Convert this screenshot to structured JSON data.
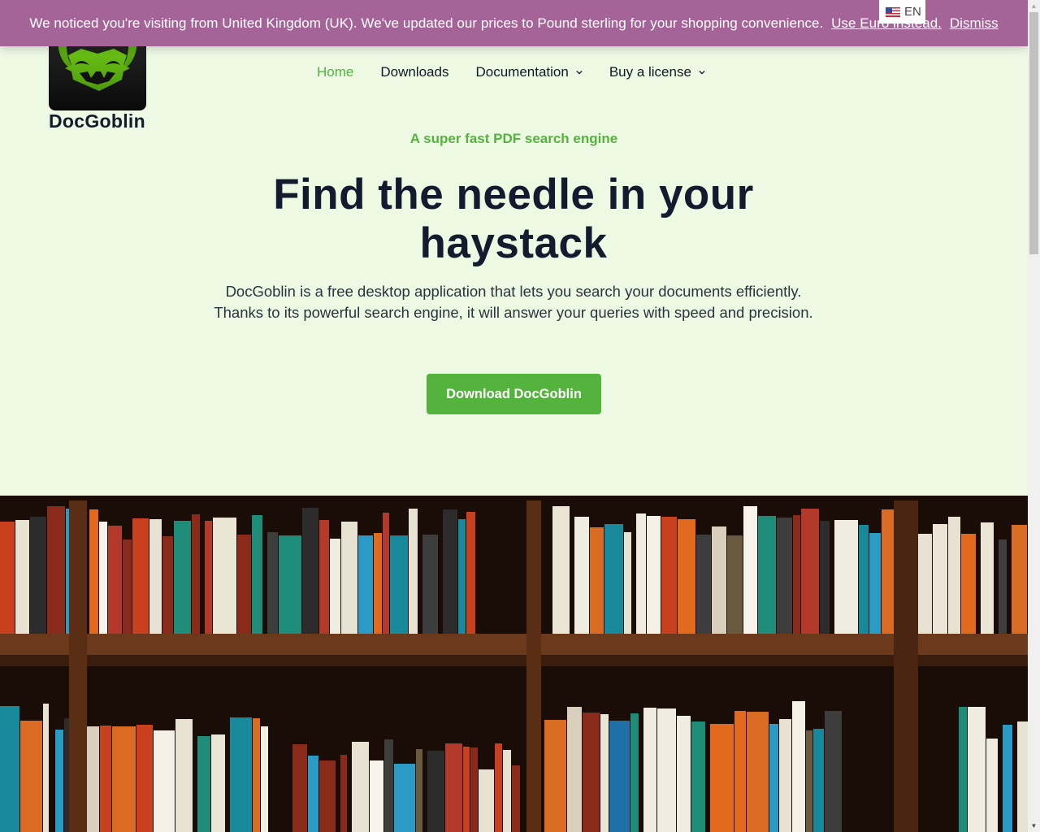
{
  "notice": {
    "message": "We noticed you're visiting from United Kingdom (UK). We've updated our prices to Pound sterling for your shopping convenience.",
    "switch_link": "Use Euro instead.",
    "dismiss_link": "Dismiss",
    "background_color": "#a46497"
  },
  "language": {
    "flag_icon": "us-flag-icon",
    "code": "EN"
  },
  "brand": {
    "name": "DocGoblin",
    "logo_icon": "goblin-face-icon",
    "accent_color": "#54b33d"
  },
  "nav": {
    "items": [
      {
        "label": "Home",
        "active": true
      },
      {
        "label": "Downloads",
        "active": false
      },
      {
        "label": "Documentation",
        "has_dropdown": true
      },
      {
        "label": "Buy a license",
        "has_dropdown": true
      }
    ]
  },
  "hero": {
    "tagline": "A super fast PDF search engine",
    "headline_line1": "Find the needle in your",
    "headline_line2": "haystack",
    "lead": "DocGoblin is a free desktop application that lets you search your documents efficiently. Thanks to its powerful search engine, it will answer your queries with speed and precision.",
    "cta_label": "Download DocGoblin"
  },
  "image": {
    "description": "Bookshelf filled with language dictionaries and textbooks"
  }
}
